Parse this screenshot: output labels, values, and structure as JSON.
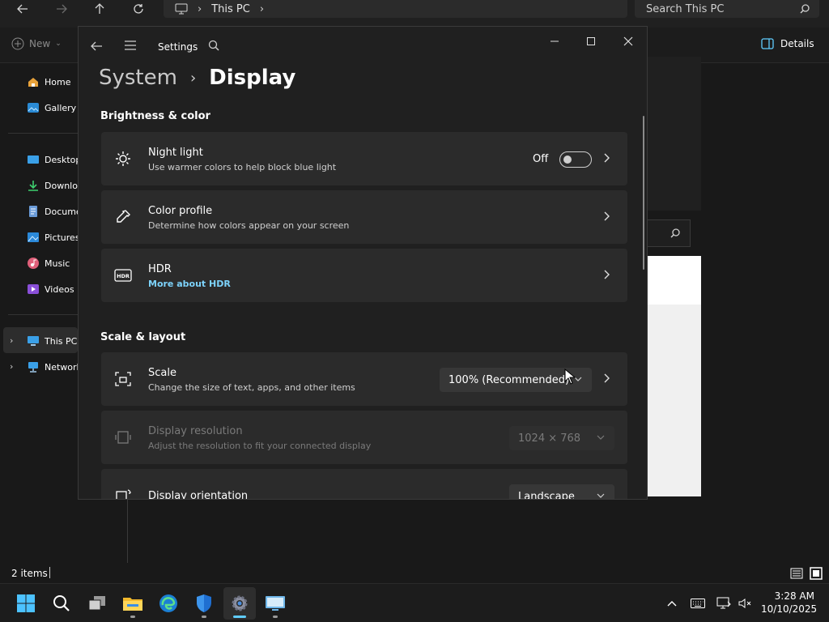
{
  "explorer": {
    "address_crumb": "This PC",
    "search_placeholder": "Search This PC",
    "new_label": "New",
    "details_label": "Details",
    "sidebar": {
      "quick": [
        {
          "label": "Home",
          "icon": "home-icon"
        },
        {
          "label": "Gallery",
          "icon": "gallery-icon"
        }
      ],
      "folders": [
        {
          "label": "Desktop",
          "icon": "desktop-folder-icon"
        },
        {
          "label": "Downloa",
          "icon": "downloads-icon"
        },
        {
          "label": "Documen",
          "icon": "documents-icon"
        },
        {
          "label": "Pictures",
          "icon": "pictures-icon"
        },
        {
          "label": "Music",
          "icon": "music-icon"
        },
        {
          "label": "Videos",
          "icon": "videos-icon"
        }
      ],
      "drives": [
        {
          "label": "This PC",
          "icon": "this-pc-icon",
          "selected": true
        },
        {
          "label": "Network",
          "icon": "network-icon"
        }
      ]
    },
    "status": "2 items"
  },
  "settings": {
    "app_title": "Settings",
    "breadcrumb": {
      "parent": "System",
      "current": "Display"
    },
    "sections": {
      "brightness": "Brightness & color",
      "scale_layout": "Scale & layout"
    },
    "night_light": {
      "title": "Night light",
      "subtitle": "Use warmer colors to help block blue light",
      "state": "Off"
    },
    "color_profile": {
      "title": "Color profile",
      "subtitle": "Determine how colors appear on your screen"
    },
    "hdr": {
      "title": "HDR",
      "link": "More about HDR"
    },
    "scale": {
      "title": "Scale",
      "subtitle": "Change the size of text, apps, and other items",
      "value": "100% (Recommended)"
    },
    "resolution": {
      "title": "Display resolution",
      "subtitle": "Adjust the resolution to fit your connected display",
      "value": "1024 × 768"
    },
    "orientation": {
      "title": "Display orientation",
      "value": "Landscape"
    }
  },
  "taskbar": {
    "time": "3:28 AM",
    "date": "10/10/2025",
    "accent": "#60cdff"
  }
}
